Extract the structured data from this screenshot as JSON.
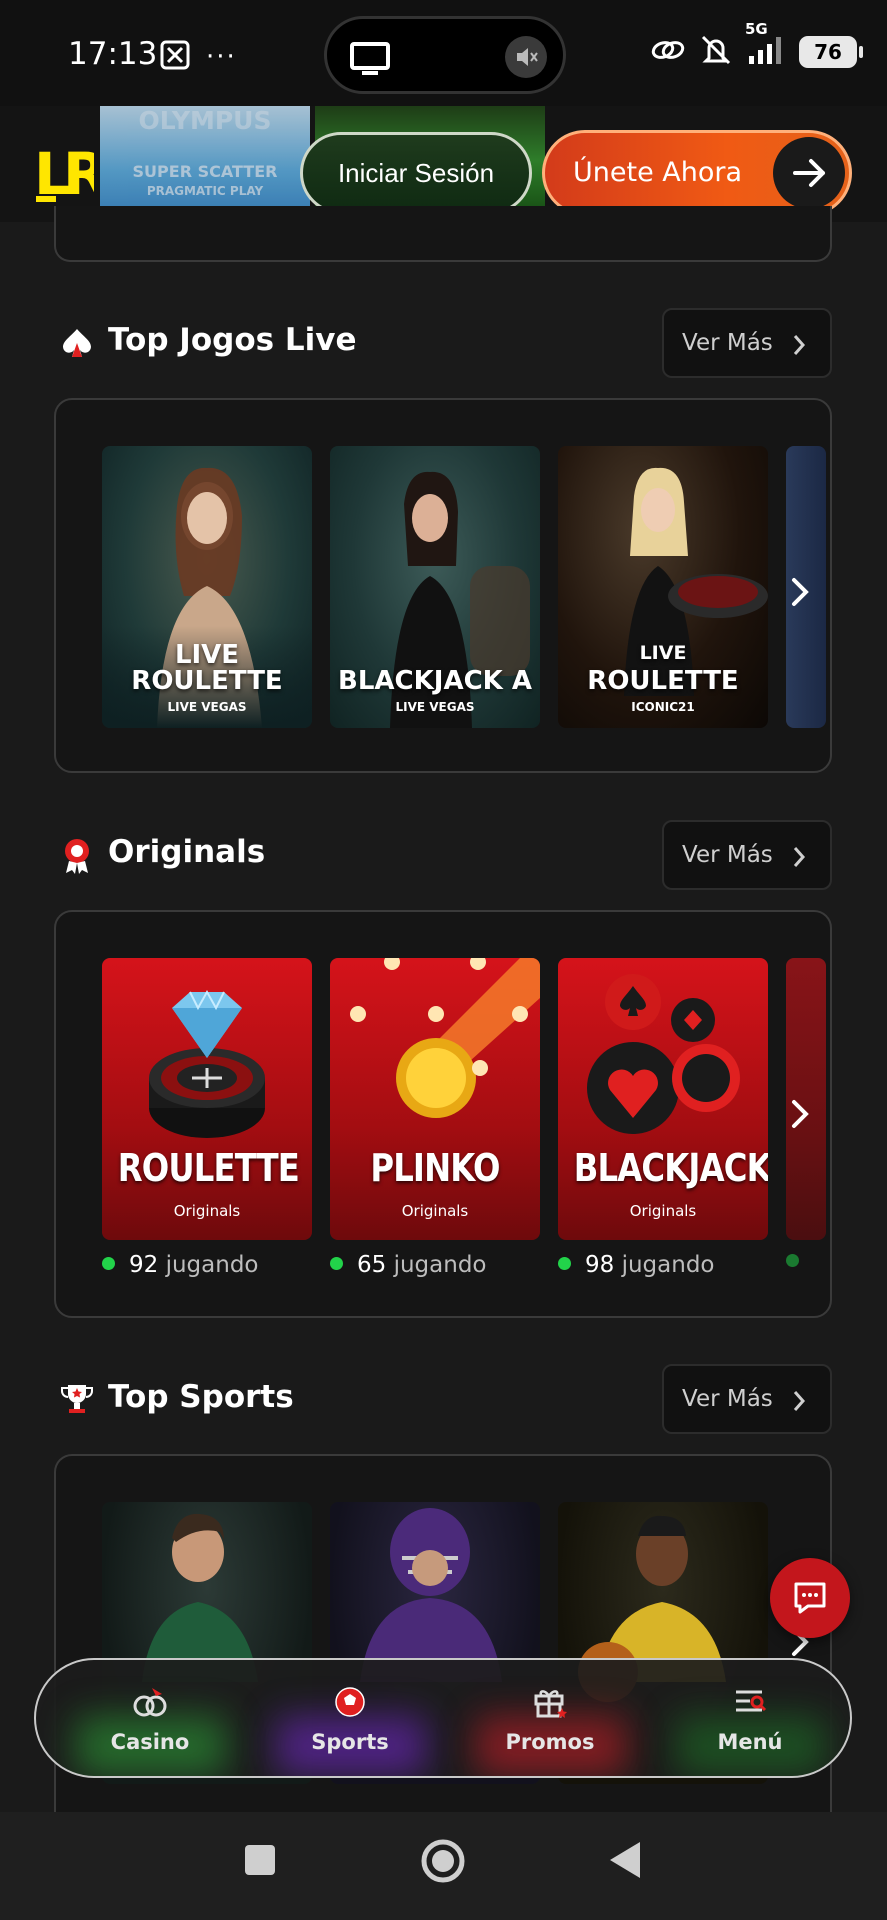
{
  "status_bar": {
    "time": "17:13",
    "network": "5G",
    "battery": "76"
  },
  "header": {
    "logo": "LR",
    "banner_title": "OLYMPUS",
    "banner_subtitle": "SUPER SCATTER",
    "banner_provider": "PRAGMATIC PLAY",
    "login_label": "Iniciar Sesión",
    "join_label": "Únete Ahora"
  },
  "sections": {
    "live": {
      "title": "Top Jogos Live",
      "more_label": "Ver Más",
      "cards": [
        {
          "line1": "LIVE",
          "line2": "ROULETTE",
          "provider": "LIVE VEGAS"
        },
        {
          "line1": "",
          "line2": "BLACKJACK A",
          "provider": "LIVE VEGAS"
        },
        {
          "line1": "LIVE",
          "line2": "ROULETTE",
          "provider": "ICONIC21"
        }
      ]
    },
    "originals": {
      "title": "Originals",
      "more_label": "Ver Más",
      "cards": [
        {
          "title": "ROULETTE",
          "subtitle": "Originals",
          "players": "92",
          "players_label": "jugando"
        },
        {
          "title": "PLINKO",
          "subtitle": "Originals",
          "players": "65",
          "players_label": "jugando"
        },
        {
          "title": "BLACKJACK",
          "subtitle": "Originals",
          "players": "98",
          "players_label": "jugando"
        }
      ]
    },
    "sports": {
      "title": "Top Sports",
      "more_label": "Ver Más"
    }
  },
  "bottom_nav": {
    "items": [
      {
        "label": "Casino",
        "icon": "casino-chips-icon"
      },
      {
        "label": "Sports",
        "icon": "soccer-ball-icon"
      },
      {
        "label": "Promos",
        "icon": "gift-icon"
      },
      {
        "label": "Menú",
        "icon": "menu-search-icon"
      }
    ]
  },
  "colors": {
    "accent_red": "#c3161c",
    "join_orange": "#f05a14",
    "logo_yellow": "#ffe600",
    "online_green": "#22d34a",
    "background": "#1a1a1a"
  }
}
